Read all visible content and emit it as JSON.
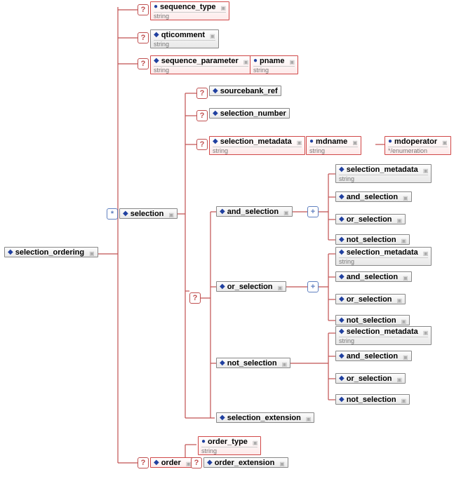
{
  "diagram": {
    "nodes": {
      "selection_ordering": {
        "label": "selection_ordering",
        "type": ""
      },
      "sequence_type": {
        "label": "sequence_type",
        "type": "string"
      },
      "qticomment": {
        "label": "qticomment",
        "type": "string"
      },
      "sequence_parameter": {
        "label": "sequence_parameter",
        "type": "string"
      },
      "pname": {
        "label": "pname",
        "type": "string"
      },
      "selection": {
        "label": "selection",
        "type": ""
      },
      "sourcebank_ref": {
        "label": "sourcebank_ref",
        "type": ""
      },
      "selection_number": {
        "label": "selection_number",
        "type": ""
      },
      "selection_metadata": {
        "label": "selection_metadata",
        "type": "string"
      },
      "mdname": {
        "label": "mdname",
        "type": "string"
      },
      "mdoperator": {
        "label": "mdoperator",
        "type": "*/enumeration"
      },
      "and_selection": {
        "label": "and_selection",
        "type": ""
      },
      "or_selection": {
        "label": "or_selection",
        "type": ""
      },
      "not_selection": {
        "label": "not_selection",
        "type": ""
      },
      "and_sm": {
        "label": "selection_metadata",
        "type": "string"
      },
      "and_and": {
        "label": "and_selection",
        "type": ""
      },
      "and_or": {
        "label": "or_selection",
        "type": ""
      },
      "and_not": {
        "label": "not_selection",
        "type": ""
      },
      "or_sm": {
        "label": "selection_metadata",
        "type": "string"
      },
      "or_and": {
        "label": "and_selection",
        "type": ""
      },
      "or_or": {
        "label": "or_selection",
        "type": ""
      },
      "or_not": {
        "label": "not_selection",
        "type": ""
      },
      "not_sm": {
        "label": "selection_metadata",
        "type": "string"
      },
      "not_and": {
        "label": "and_selection",
        "type": ""
      },
      "not_or": {
        "label": "or_selection",
        "type": ""
      },
      "not_not": {
        "label": "not_selection",
        "type": ""
      },
      "selection_extension": {
        "label": "selection_extension",
        "type": ""
      },
      "order": {
        "label": "order",
        "type": ""
      },
      "order_type": {
        "label": "order_type",
        "type": "string"
      },
      "order_extension": {
        "label": "order_extension",
        "type": ""
      }
    },
    "joints": {
      "q_seqtype": {
        "glyph": "?",
        "style": "red"
      },
      "q_qti": {
        "glyph": "?",
        "style": "red"
      },
      "q_seqparam": {
        "glyph": "?",
        "style": "red"
      },
      "star_sel": {
        "glyph": "*",
        "style": "blue"
      },
      "q_src": {
        "glyph": "?",
        "style": "red"
      },
      "q_selnum": {
        "glyph": "?",
        "style": "red"
      },
      "q_selmeta": {
        "glyph": "?",
        "style": "red"
      },
      "q_selgroup": {
        "glyph": "?",
        "style": "red"
      },
      "plus_and": {
        "glyph": "+",
        "style": "blue"
      },
      "plus_or": {
        "glyph": "+",
        "style": "blue"
      },
      "q_order": {
        "glyph": "?",
        "style": "red"
      },
      "q_orderext": {
        "glyph": "?",
        "style": "red"
      }
    }
  }
}
